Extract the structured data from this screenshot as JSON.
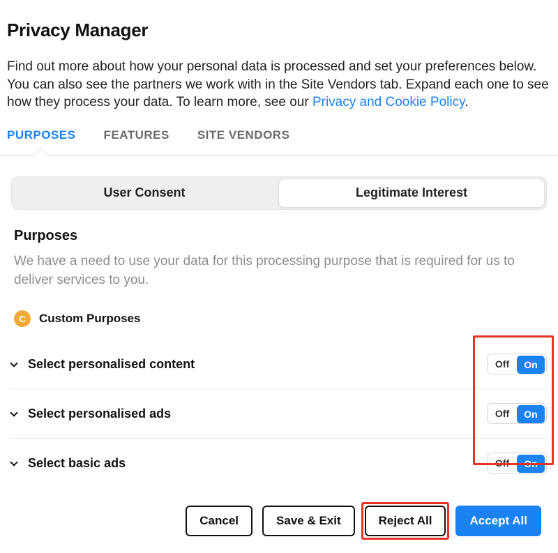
{
  "title": "Privacy Manager",
  "intro": {
    "text_before": "Find out more about how your personal data is processed and set your preferences below. You can also see the partners we work with in the Site Vendors tab. Expand each one to see how they process your data. To learn more, see our ",
    "link_text": "Privacy and Cookie Policy",
    "text_after": "."
  },
  "tabs": {
    "purposes": "PURPOSES",
    "features": "FEATURES",
    "site_vendors": "SITE VENDORS"
  },
  "segmented": {
    "user_consent": "User Consent",
    "legitimate_interest": "Legitimate Interest"
  },
  "section": {
    "title": "Purposes",
    "description": "We have a need to use your data for this processing purpose that is required for us to deliver services to you."
  },
  "custom": {
    "badge": "C",
    "label": "Custom Purposes"
  },
  "toggle_labels": {
    "off": "Off",
    "on": "On"
  },
  "items": [
    {
      "label": "Select personalised content",
      "state": "on"
    },
    {
      "label": "Select personalised ads",
      "state": "on"
    },
    {
      "label": "Select basic ads",
      "state": "on"
    }
  ],
  "buttons": {
    "cancel": "Cancel",
    "save_exit": "Save & Exit",
    "reject_all": "Reject All",
    "accept_all": "Accept All"
  }
}
